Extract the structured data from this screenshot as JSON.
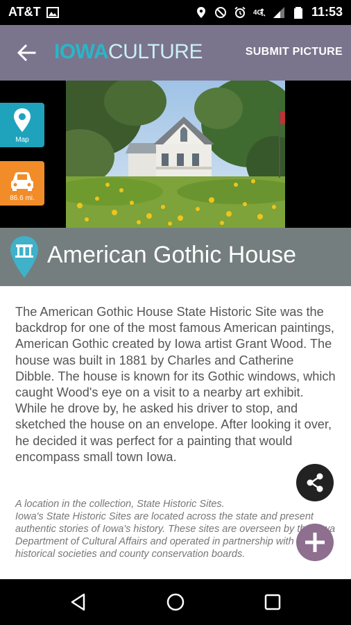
{
  "status_bar": {
    "carrier": "AT&T",
    "time": "11:53"
  },
  "app_bar": {
    "logo_part1": "IOWA",
    "logo_part2": "CULTURE",
    "submit_label": "SUBMIT PICTURE"
  },
  "side_buttons": {
    "map_label": "Map",
    "distance_label": "86.6 mi."
  },
  "site": {
    "title": "American Gothic House",
    "description": "The American Gothic House State Historic Site was the backdrop for one of the most famous American paintings, American Gothic created by Iowa artist Grant Wood. The house was built in 1881 by Charles and Catherine Dibble. The house is known for its Gothic windows, which caught Wood's eye on a visit to a nearby art exhibit. While he drove by, he asked his driver to stop, and sketched the house on an envelope. After looking it over, he decided it was perfect for a painting that would encompass small town Iowa.",
    "collection_note_line1": "A location in the collection, State Historic Sites.",
    "collection_note_line2": "Iowa's State Historic Sites are located across the state and present authentic stories of Iowa's history. These sites are overseen by the Iowa Department of Cultural Affairs and operated in partnership with local historical societies and county conservation boards."
  },
  "colors": {
    "app_bar": "#7b748d",
    "title_bar": "#747e7e",
    "map_button": "#1fa3bd",
    "distance_button": "#f28c28",
    "share_fab": "#222222",
    "add_fab": "#8e6f8f"
  },
  "icons": [
    "back-arrow-icon",
    "map-pin-icon",
    "car-icon",
    "column-pin-icon",
    "share-icon",
    "plus-icon",
    "nav-back-icon",
    "nav-home-icon",
    "nav-recents-icon"
  ]
}
